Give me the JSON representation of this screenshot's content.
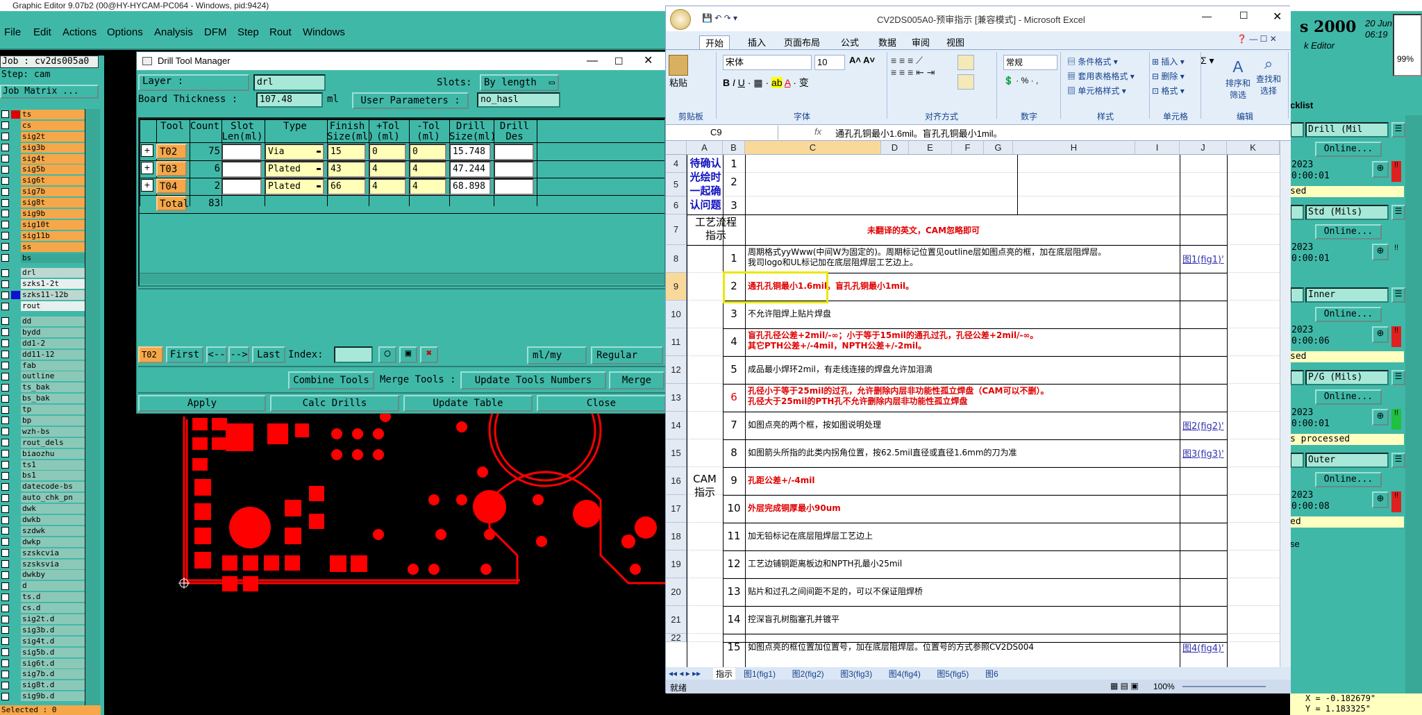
{
  "app": {
    "title": "Graphic Editor 9.07b2 (00@HY-HYCAM-PC064 - Windows, pid:9424)",
    "menu": [
      "File",
      "Edit",
      "Actions",
      "Options",
      "Analysis",
      "DFM",
      "Step",
      "Rout",
      "Windows"
    ],
    "job_label": "Job : cv2ds005a0",
    "step_label": "Step: cam",
    "job_matrix": "Job Matrix ...",
    "selected": "Selected : 0",
    "header_right_title": "s 2000",
    "header_right_sub": "k Editor",
    "header_date": "20 Jun",
    "header_time": "06:19",
    "zoom_pct": "99%",
    "coord_x": "X = -0.182679\"",
    "coord_y": "Y = 1.183325\""
  },
  "layers": [
    {
      "name": "ts",
      "bg": "o",
      "color": "#e00000"
    },
    {
      "name": "cs",
      "bg": "o",
      "color": ""
    },
    {
      "name": "sig2t",
      "bg": "o",
      "color": ""
    },
    {
      "name": "sig3b",
      "bg": "o",
      "color": ""
    },
    {
      "name": "sig4t",
      "bg": "o",
      "color": ""
    },
    {
      "name": "sig5b",
      "bg": "o",
      "color": ""
    },
    {
      "name": "sig6t",
      "bg": "o",
      "color": ""
    },
    {
      "name": "sig7b",
      "bg": "o",
      "color": ""
    },
    {
      "name": "sig8t",
      "bg": "o",
      "color": ""
    },
    {
      "name": "sig9b",
      "bg": "o",
      "color": ""
    },
    {
      "name": "sig10t",
      "bg": "o",
      "color": ""
    },
    {
      "name": "sig11b",
      "bg": "o",
      "color": ""
    },
    {
      "name": "ss",
      "bg": "o",
      "color": ""
    },
    {
      "name": "bs",
      "bg": "t",
      "color": ""
    },
    {
      "name": "",
      "bg": "sep",
      "color": ""
    },
    {
      "name": "drl",
      "bg": "s",
      "color": ""
    },
    {
      "name": "szks1-2t",
      "bg": "w",
      "color": ""
    },
    {
      "name": "szks11-12b",
      "bg": "b",
      "color": "#1010d0"
    },
    {
      "name": "rout",
      "bg": "w",
      "color": ""
    },
    {
      "name": "",
      "bg": "sep",
      "color": ""
    },
    {
      "name": "dd",
      "bg": "g",
      "color": ""
    },
    {
      "name": "bydd",
      "bg": "g",
      "color": ""
    },
    {
      "name": "dd1-2",
      "bg": "g",
      "color": ""
    },
    {
      "name": "dd11-12",
      "bg": "g",
      "color": ""
    },
    {
      "name": "fab",
      "bg": "g",
      "color": ""
    },
    {
      "name": "outline",
      "bg": "g",
      "color": ""
    },
    {
      "name": "ts_bak",
      "bg": "g",
      "color": ""
    },
    {
      "name": "bs_bak",
      "bg": "g",
      "color": ""
    },
    {
      "name": "tp",
      "bg": "g",
      "color": ""
    },
    {
      "name": "bp",
      "bg": "g",
      "color": ""
    },
    {
      "name": "wzh-bs",
      "bg": "g",
      "color": ""
    },
    {
      "name": "rout_dels",
      "bg": "g",
      "color": ""
    },
    {
      "name": "biaozhu",
      "bg": "g",
      "color": ""
    },
    {
      "name": "ts1",
      "bg": "g",
      "color": ""
    },
    {
      "name": "bs1",
      "bg": "g",
      "color": ""
    },
    {
      "name": "datecode-bs",
      "bg": "g",
      "color": ""
    },
    {
      "name": "auto_chk_pn",
      "bg": "g",
      "color": ""
    },
    {
      "name": "dwk",
      "bg": "g",
      "color": ""
    },
    {
      "name": "dwkb",
      "bg": "g",
      "color": ""
    },
    {
      "name": "szdwk",
      "bg": "g",
      "color": ""
    },
    {
      "name": "dwkp",
      "bg": "g",
      "color": ""
    },
    {
      "name": "szskcvia",
      "bg": "g",
      "color": ""
    },
    {
      "name": "szsksvia",
      "bg": "g",
      "color": ""
    },
    {
      "name": "dwkby",
      "bg": "g",
      "color": ""
    },
    {
      "name": "d",
      "bg": "g",
      "color": ""
    },
    {
      "name": "ts.d",
      "bg": "g",
      "color": ""
    },
    {
      "name": "cs.d",
      "bg": "g",
      "color": ""
    },
    {
      "name": "sig2t.d",
      "bg": "g",
      "color": ""
    },
    {
      "name": "sig3b.d",
      "bg": "g",
      "color": ""
    },
    {
      "name": "sig4t.d",
      "bg": "g",
      "color": ""
    },
    {
      "name": "sig5b.d",
      "bg": "g",
      "color": ""
    },
    {
      "name": "sig6t.d",
      "bg": "g",
      "color": ""
    },
    {
      "name": "sig7b.d",
      "bg": "g",
      "color": ""
    },
    {
      "name": "sig8t.d",
      "bg": "g",
      "color": ""
    },
    {
      "name": "sig9b.d",
      "bg": "g",
      "color": ""
    }
  ],
  "dtm": {
    "title": "Drill Tool Manager",
    "layer_label": "Layer :",
    "layer_value": "drl",
    "slots_label": "Slots:",
    "slots_value": "By length",
    "thickness_label": "Board Thickness :",
    "thickness_value": "107.48",
    "thickness_unit": "ml",
    "user_params_label": "User Parameters :",
    "user_params_value": "no_hasl",
    "headers": [
      "Tool",
      "Count",
      "Slot\nLen(ml)",
      "Type",
      "Finish\nSize(ml)",
      "+Tol\n(ml)",
      "-Tol\n(ml)",
      "Drill\nSize(ml)",
      "Drill\nDes"
    ],
    "rows": [
      {
        "tool": "T02",
        "count": "75",
        "slot": "",
        "type": "Via",
        "finish": "15",
        "ptol": "0",
        "mtol": "0",
        "drill": "15.748",
        "des": ""
      },
      {
        "tool": "T03",
        "count": "6",
        "slot": "",
        "type": "Plated",
        "finish": "43",
        "ptol": "4",
        "mtol": "4",
        "drill": "47.244",
        "des": ""
      },
      {
        "tool": "T04",
        "count": "2",
        "slot": "",
        "type": "Plated",
        "finish": "66",
        "ptol": "4",
        "mtol": "4",
        "drill": "68.898",
        "des": ""
      }
    ],
    "total_label": "Total",
    "total_value": "83",
    "nav_tool": "T02",
    "first": "First",
    "prev": "<--",
    "next": "-->",
    "last": "Last",
    "index_label": "Index:",
    "units": "ml/my",
    "mode": "Regular",
    "combine": "Combine Tools",
    "merge_label": "Merge Tools :",
    "update_numbers": "Update Tools Numbers",
    "merge": "Merge",
    "apply": "Apply",
    "calc": "Calc Drills",
    "update_table": "Update Table",
    "close": "Close"
  },
  "excel": {
    "title": "CV2DS005A0-预审指示 [兼容模式] - Microsoft Excel",
    "tabs": [
      "开始",
      "插入",
      "页面布局",
      "公式",
      "数据",
      "审阅",
      "视图"
    ],
    "font_name": "宋体",
    "font_size": "10",
    "number_format": "常规",
    "groups": [
      "剪贴板",
      "字体",
      "对齐方式",
      "数字",
      "样式",
      "单元格",
      "编辑"
    ],
    "ribbon_items": {
      "paste": "粘贴",
      "cond_format": "条件格式",
      "table_format": "套用表格格式",
      "cell_style": "单元格样式",
      "insert": "插入",
      "delete": "删除",
      "format": "格式",
      "sort": "排序和\n筛选",
      "find": "查找和\n选择"
    },
    "name_box": "C9",
    "formula": "通孔孔铜最小1.6mil。盲孔孔铜最小1mil。",
    "columns": [
      "A",
      "B",
      "C",
      "D",
      "E",
      "F",
      "G",
      "H",
      "I",
      "J",
      "K"
    ],
    "row_numbers": [
      "4",
      "5",
      "6",
      "7",
      "8",
      "9",
      "10",
      "11",
      "12",
      "13",
      "14",
      "15",
      "16",
      "17",
      "18",
      "19",
      "20",
      "21",
      "22"
    ],
    "section_pending": "待确认\n光绘时\n一起确\n认问题",
    "section_process": "工艺流程\n指示",
    "section_cam": "CAM\n指示",
    "process_note": "未翻译的英文，CAM忽略即可",
    "pending_nums": [
      "1",
      "2",
      "3"
    ],
    "items": [
      {
        "n": "1",
        "text": "周期格式yyWww(中间W为固定的)。周期标记位置见outline层如图点亮的框，加在底层阻焊层。\n我司logo和UL标记加在底层阻焊层工艺边上。",
        "red": false,
        "link": "图1(fig1)'"
      },
      {
        "n": "2",
        "text": "通孔孔铜最小1.6mil。盲孔孔铜最小1mil。",
        "red": true,
        "link": ""
      },
      {
        "n": "3",
        "text": "不允许阻焊上贴片焊盘",
        "red": false,
        "link": ""
      },
      {
        "n": "4",
        "text": "盲孔孔径公差+2mil/-∞；小于等于15mil的通孔过孔，孔径公差+2mil/-∞。\n其它PTH公差+/-4mil，NPTH公差+/-2mil。",
        "red": true,
        "link": ""
      },
      {
        "n": "5",
        "text": "成品最小焊环2mil，有走线连接的焊盘允许加泪滴",
        "red": false,
        "link": ""
      },
      {
        "n": "6",
        "text": "孔径小于等于25mil的过孔，允许删除内层非功能性孤立焊盘（CAM可以不删）。\n孔径大于25mil的PTH孔不允许删除内层非功能性孤立焊盘",
        "red": true,
        "link": ""
      },
      {
        "n": "7",
        "text": "如图点亮的两个框，按如图说明处理",
        "red": false,
        "link": "图2(fig2)'"
      },
      {
        "n": "8",
        "text": "如图箭头所指的此类内拐角位置，按62.5mil直径或直径1.6mm的刀为准",
        "red": false,
        "link": "图3(fig3)'"
      },
      {
        "n": "9",
        "text": "孔距公差+/-4mil",
        "red": true,
        "link": ""
      },
      {
        "n": "10",
        "text": "外层完成铜厚最小90um",
        "red": true,
        "link": ""
      },
      {
        "n": "11",
        "text": "加无铅标记在底层阻焊层工艺边上",
        "red": false,
        "link": ""
      },
      {
        "n": "12",
        "text": "工艺边铺铜距离板边和NPTH孔最小25mil",
        "red": false,
        "link": ""
      },
      {
        "n": "13",
        "text": "贴片和过孔之间间距不足的，可以不保证阻焊桥",
        "red": false,
        "link": ""
      },
      {
        "n": "14",
        "text": "控深盲孔树脂塞孔并镀平",
        "red": false,
        "link": ""
      },
      {
        "n": "15",
        "text": "如图点亮的框位置加位置号，加在底层阻焊层。位置号的方式参照CV2DS004",
        "red": false,
        "link": "图4(fig4)'"
      }
    ],
    "sheet_tabs": [
      "指示",
      "图1(fig1)",
      "图2(fig2)",
      "图3(fig3)",
      "图4(fig4)",
      "图5(fig5)",
      "图6"
    ],
    "status": "就绪",
    "zoom": "100%"
  },
  "right_panel": {
    "title": "cklist",
    "cards": [
      {
        "field": "Drill (Mil",
        "btn": "Online...",
        "year": "2023",
        "time": "0:00:01",
        "status": "sed",
        "state": "red"
      },
      {
        "field": "Std (Mils)",
        "btn": "Online...",
        "year": "2023",
        "time": "0:00:01",
        "status": "",
        "state": "none"
      },
      {
        "field": "Inner",
        "btn": "Online...",
        "year": "2023",
        "time": "0:00:06",
        "status": "sed",
        "state": "red"
      },
      {
        "field": "P/G (Mils)",
        "btn": "Online...",
        "year": "2023",
        "time": "0:00:01",
        "status": "s processed",
        "state": "green"
      },
      {
        "field": "Outer",
        "btn": "Online...",
        "year": "2023",
        "time": "0:00:08",
        "status": "ed",
        "state": "red"
      }
    ],
    "footer": "se"
  },
  "colors": {
    "teal": "#40b8a8",
    "orange": "#f5a74a",
    "pcb_red": "#ff0000",
    "highlight": "#e8e800"
  }
}
